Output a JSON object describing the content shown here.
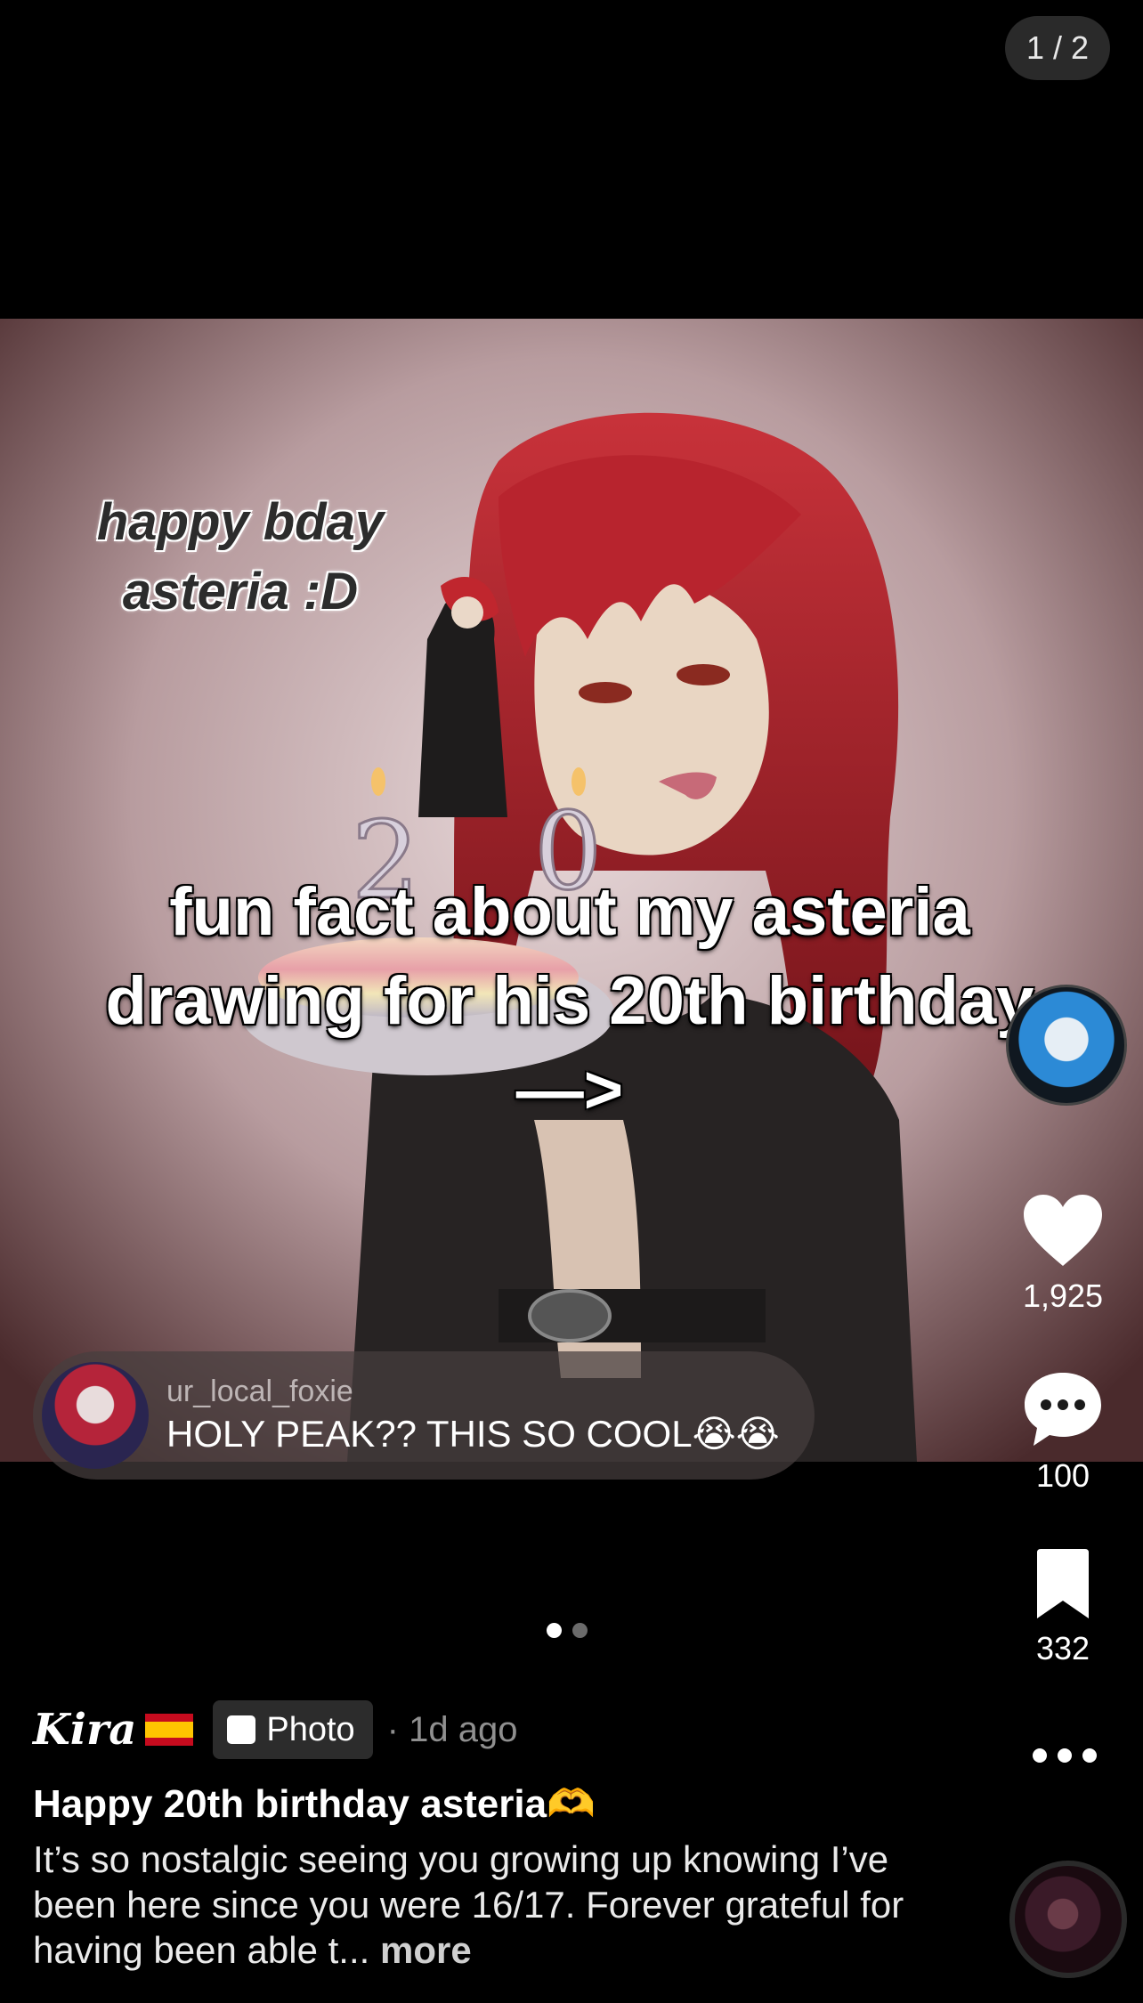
{
  "counter": "1 / 2",
  "overlay": {
    "corner_line1": "happy bday",
    "corner_line2": "asteria :D",
    "main_line1": "fun fact about my asteria",
    "main_line2": "drawing for his 20th birthday",
    "main_line3": "—>"
  },
  "comment": {
    "username": "ur_local_foxie",
    "text": "HOLY PEAK?? THIS SO COOL😭😭"
  },
  "actions": {
    "likes": "1,925",
    "comments": "100",
    "saves": "332"
  },
  "pager": {
    "total": 2,
    "active": 0
  },
  "post": {
    "author": "Kira",
    "type_badge": "Photo",
    "time": "· 1d ago",
    "title": "Happy 20th birthday asteria🫶",
    "description": "It’s so nostalgic seeing you growing up knowing I’ve been here since you were 16/17. Forever grateful for having been able t...",
    "more_label": "more"
  },
  "colors": {
    "background": "#000000",
    "pill_bg": "#2a2a2a",
    "hair_red": "#a8202a",
    "pager_active": "#ffffff",
    "pager_inactive": "#6b6b6b"
  }
}
